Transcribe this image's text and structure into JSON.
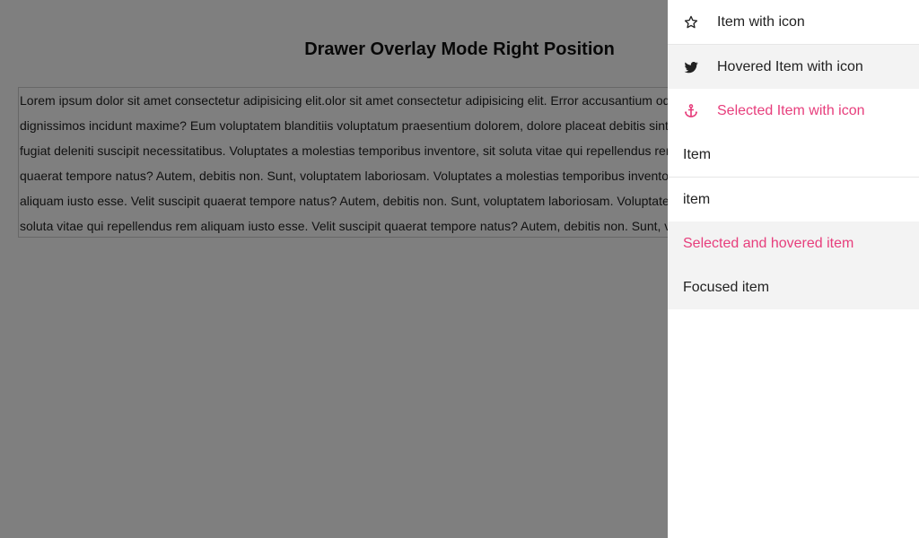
{
  "page": {
    "title": "Drawer Overlay Mode Right Position",
    "body_text": "Lorem ipsum dolor sit amet consectetur adipisicing elit.olor sit amet consectetur adipisicing elit. Error accusantium odit nulla quas ad aliquid debitis dignissimos incidunt maxime? Eum voluptatem blanditiis voluptatum praesentium dolorem, dolore placeat debitis sint aut officiis cupiditate quaerat quam fugiat deleniti suscipit necessitatibus. Voluptates a molestias temporibus inventore, sit soluta vitae qui repellendus rem aliquam iusto esse. Velit suscipit quaerat tempore natus? Autem, debitis non. Sunt, voluptatem laboriosam. Voluptates a molestias temporibus inventore, sit soluta vitae qui repellendus rem aliquam iusto esse. Velit suscipit quaerat tempore natus? Autem, debitis non. Sunt, voluptatem laboriosam. Voluptates a molestias temporibus inventore, sit soluta vitae qui repellendus rem aliquam iusto esse. Velit suscipit quaerat tempore natus? Autem, debitis non. Sunt, voluptatem laboriosam."
  },
  "drawer": {
    "items": [
      {
        "label": "Item with icon",
        "icon": "star-outline-icon"
      },
      {
        "label": "Hovered Item with icon",
        "icon": "twitter-icon"
      },
      {
        "label": "Selected Item with icon",
        "icon": "anchor-icon"
      },
      {
        "label": "Item"
      },
      {
        "label": "item"
      },
      {
        "label": "Selected and hovered item"
      },
      {
        "label": "Focused item"
      }
    ]
  },
  "colors": {
    "accent": "#e73e7c",
    "overlay": "rgba(0,0,0,0.5)",
    "hover_bg": "#f3f3f3"
  }
}
